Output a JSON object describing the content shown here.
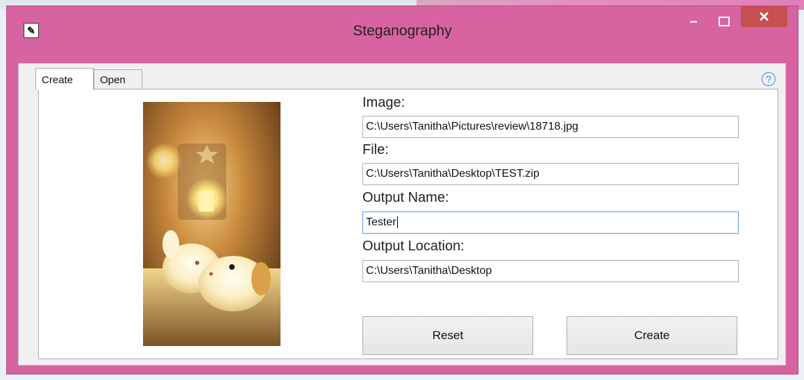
{
  "window": {
    "title": "Steganography",
    "minimize_glyph": "–",
    "close_glyph": "✕",
    "app_icon_glyph": "✎"
  },
  "tabs": [
    {
      "label": "Create",
      "selected": true
    },
    {
      "label": "Open",
      "selected": false
    }
  ],
  "help_glyph": "?",
  "form": {
    "image_label": "Image:",
    "image_value": "C:\\Users\\Tanitha\\Pictures\\review\\18718.jpg",
    "file_label": "File:",
    "file_value": "C:\\Users\\Tanitha\\Desktop\\TEST.zip",
    "output_name_label": "Output Name:",
    "output_name_value": "Tester",
    "output_location_label": "Output Location:",
    "output_location_value": "C:\\Users\\Tanitha\\Desktop"
  },
  "buttons": {
    "reset": "Reset",
    "create": "Create"
  },
  "colors": {
    "titlebar": "#d764a0",
    "close_button": "#c75050",
    "focus_border": "#569de5"
  }
}
